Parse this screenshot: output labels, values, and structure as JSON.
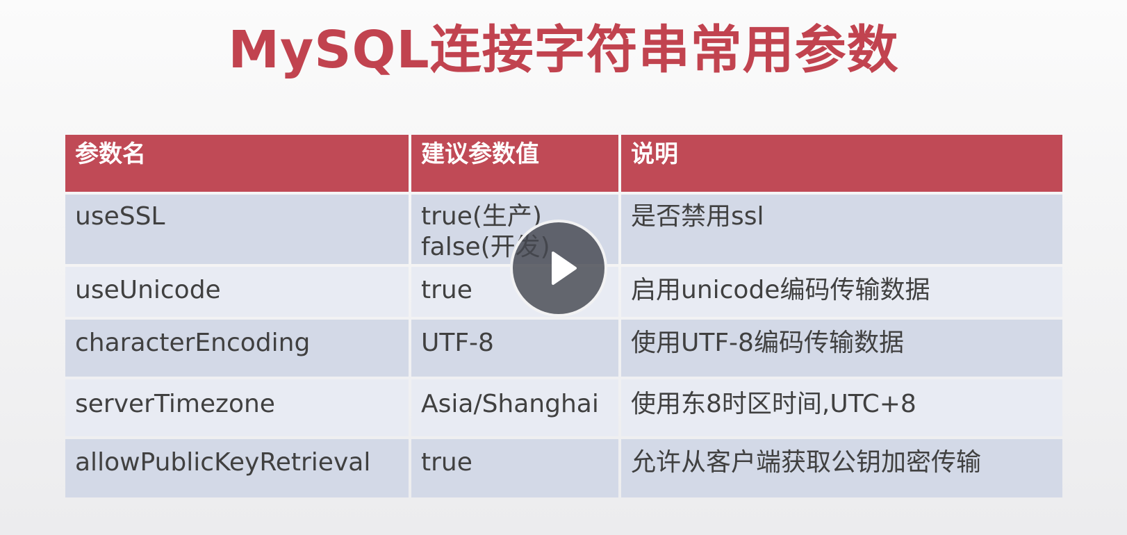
{
  "slide": {
    "title": "MySQL连接字符串常用参数"
  },
  "table": {
    "headers": [
      "参数名",
      "建议参数值",
      "说明"
    ],
    "rows": [
      {
        "name": "useSSL",
        "value_lines": [
          "true(生产)",
          "false(开发)"
        ],
        "desc": "是否禁用ssl"
      },
      {
        "name": "useUnicode",
        "value_lines": [
          "true"
        ],
        "desc": "启用unicode编码传输数据"
      },
      {
        "name": "characterEncoding",
        "value_lines": [
          "UTF-8"
        ],
        "desc": "使用UTF-8编码传输数据"
      },
      {
        "name": "serverTimezone",
        "value_lines": [
          "Asia/Shanghai"
        ],
        "desc": "使用东8时区时间,UTC+8"
      },
      {
        "name": "allowPublicKeyRetrieval",
        "value_lines": [
          "true"
        ],
        "desc": "允许从客户端获取公钥加密传输"
      }
    ]
  },
  "player": {
    "icon": "play-icon"
  },
  "colors": {
    "title": "#c1434f",
    "header_bg": "#c04a56",
    "row_dark": "#d3d9e7",
    "row_light": "#e8ebf3"
  }
}
